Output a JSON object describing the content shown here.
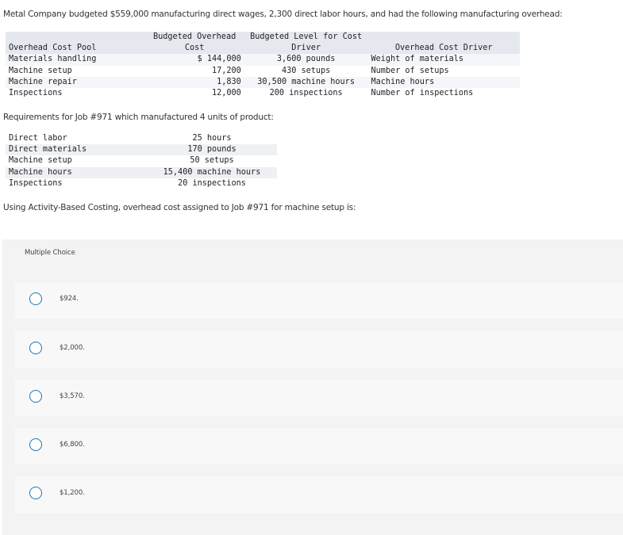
{
  "intro": "Metal Company budgeted $559,000 manufacturing direct wages, 2,300 direct labor hours, and had the following manufacturing overhead:",
  "overhead_table": {
    "headers": {
      "pool": "Overhead Cost Pool",
      "cost_line1": "Budgeted Overhead",
      "cost_line2": "Cost",
      "level_line1": "Budgeted Level for Cost",
      "level_line2": "Driver",
      "driver": "Overhead Cost Driver"
    },
    "rows": [
      {
        "pool": "Materials handling",
        "cost": "$ 144,000",
        "level": "3,600 pounds",
        "driver": "Weight of materials"
      },
      {
        "pool": "Machine setup",
        "cost": "17,200",
        "level": "430 setups",
        "driver": "Number of setups"
      },
      {
        "pool": "Machine repair",
        "cost": "1,830",
        "level": "30,500 machine hours",
        "driver": "Machine hours"
      },
      {
        "pool": "Inspections",
        "cost": "12,000",
        "level": "200 inspections",
        "driver": "Number of inspections"
      }
    ]
  },
  "requirements_label": "Requirements for Job #971 which manufactured 4 units of product:",
  "job_table": {
    "rows": [
      {
        "label": "Direct labor",
        "value": "25 hours"
      },
      {
        "label": "Direct materials",
        "value": "170 pounds"
      },
      {
        "label": "Machine setup",
        "value": "50 setups"
      },
      {
        "label": "Machine hours",
        "value": "15,400 machine hours"
      },
      {
        "label": "Inspections",
        "value": "20 inspections"
      }
    ]
  },
  "question": "Using Activity-Based Costing, overhead cost assigned to Job #971 for machine setup is:",
  "multiple_choice": {
    "title": "Multiple Choice",
    "options": [
      "$924.",
      "$2,000.",
      "$3,570.",
      "$6,800.",
      "$1,200."
    ]
  },
  "colors": {
    "radio_border": "#1f78b4",
    "table_shade": "#e6e8ef",
    "panel_bg": "#f3f3f3"
  }
}
